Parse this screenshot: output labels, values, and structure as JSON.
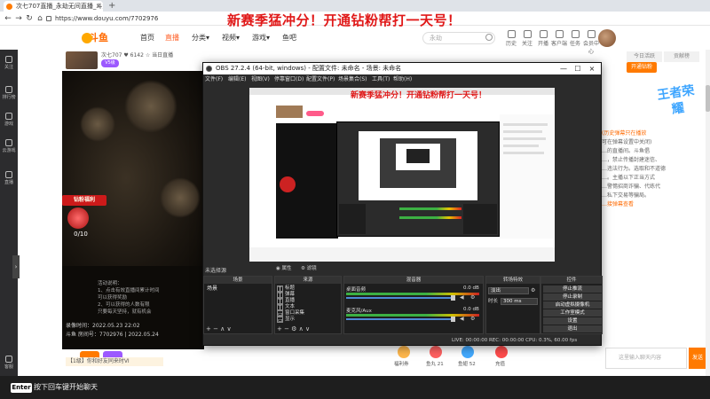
{
  "browser": {
    "tab_title": "次七707直播_永劫无间直播_斗鱼...",
    "tab_close": "×",
    "tab_new": "+",
    "url": "https://www.douyu.com/7702976",
    "nav": {
      "back": "←",
      "forward": "→",
      "reload": "↻",
      "home": "⌂"
    }
  },
  "headline": "新赛季猛冲分！开通钻粉帮打一天号！",
  "douyu": {
    "logo_text": "斗鱼",
    "nav": [
      "首页",
      "直播",
      "分类▾",
      "视频▾",
      "游戏▾",
      "鱼吧"
    ],
    "search_placeholder": "永劫",
    "header_icons": [
      "历史",
      "关注",
      "开播",
      "客户端",
      "任务",
      "会员中心"
    ],
    "room": {
      "name": "次七707  ♥ 6142  ☆ 当日直播",
      "tag": "V5级"
    }
  },
  "sidebar": [
    "关注",
    "排行榜",
    "游戏",
    "云游戏",
    "直播",
    "客服"
  ],
  "stream": {
    "promo_title": "钻粉福利",
    "promo_count": "0/10",
    "info_lines": [
      "活动说明：",
      "1、点击有效直播间累计时间",
      "可以获得奖励",
      "2、可以获得的人数有限",
      "只要每天坚持，就有机会"
    ],
    "record_time": "录像时间：2022.05.23 22:02",
    "record_id": "斗鱼 房间号：7702976 | 2022.05.24"
  },
  "chat_line": "【1级】你和好友同来时VI",
  "right_panel": {
    "tabs": [
      "今日活跃",
      "贡献榜"
    ],
    "open_btn": "开通钻粉",
    "king_logo": "王者荣耀",
    "notice": [
      "(历史弹幕只在播放",
      "可在弹幕设置中关闭)",
      "…的直播间。斗鱼倡",
      "…，禁止传播封建迷信、",
      "…违法行为。选取和不道德",
      "…。主播以下正当方式",
      "…警惕招商诈骗、代练代",
      "…私下交易等骗局。",
      "…接弹幕查看"
    ],
    "chat_placeholder": "这里输入聊天内容",
    "send": "发送"
  },
  "page_tools": [
    "福利券",
    "鱼丸 21",
    "鱼翅 52",
    "充值"
  ],
  "bottom_bar": {
    "key": "Enter",
    "hint": "按下回车键开始聊天"
  },
  "obs": {
    "title": "OBS 27.2.4 (64-bit, windows) - 配置文件: 未命名 - 场景: 未命名",
    "win_min": "—",
    "win_max": "☐",
    "win_close": "×",
    "menu": [
      "文件(F)",
      "编辑(E)",
      "视图(V)",
      "停靠窗口(D)",
      "配置文件(P)",
      "场景集合(S)",
      "工具(T)",
      "帮助(H)"
    ],
    "preview_headline": "新赛季猛冲分！开通钻粉帮打一天号！",
    "dock_header": "未选择源",
    "mode_a": "◉ 属性",
    "mode_b": "⚙ 滤镜",
    "docks": {
      "scenes": {
        "title": "场景",
        "items": [
          "场景"
        ]
      },
      "sources": {
        "title": "来源",
        "items": [
          "标题",
          "弹幕",
          "直播",
          "文本",
          "窗口采集",
          "显示"
        ]
      },
      "mixer": {
        "title": "混音器",
        "channels": [
          {
            "name": "桌面音频",
            "db": "0.0 dB"
          },
          {
            "name": "麦克风/Aux",
            "db": "0.0 dB"
          }
        ]
      },
      "transitions": {
        "title": "转场特效",
        "type": "淡出",
        "duration_label": "时长",
        "duration": "300 ms"
      },
      "controls": {
        "title": "控件",
        "buttons": [
          "停止推流",
          "停止录制",
          "启动虚拟摄像机",
          "工作室模式",
          "设置",
          "退出"
        ]
      }
    },
    "status": "LIVE: 00:00:00    REC: 00:00:00    CPU: 0.3%, 60.00 fps"
  }
}
